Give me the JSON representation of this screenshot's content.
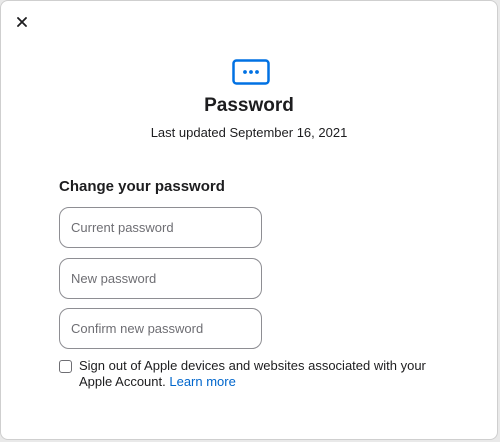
{
  "dialog": {
    "close_icon": "close-icon",
    "header_icon": "password-dots-icon",
    "accent_color": "#0071e3",
    "title": "Password",
    "subtitle": "Last updated September 16, 2021"
  },
  "form": {
    "heading": "Change your password",
    "current_password": {
      "placeholder": "Current password",
      "value": ""
    },
    "new_password": {
      "placeholder": "New password",
      "value": ""
    },
    "confirm_password": {
      "placeholder": "Confirm new password",
      "value": ""
    }
  },
  "signout_option": {
    "checked": false,
    "text": "Sign out of Apple devices and websites associated with your Apple Account.",
    "link_text": "Learn more",
    "link_color": "#0066cc"
  }
}
